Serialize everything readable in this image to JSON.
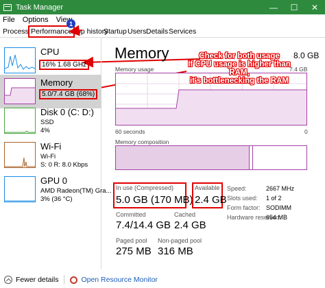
{
  "window": {
    "title": "Task Manager",
    "controls": [
      "—",
      "☐",
      "✕"
    ]
  },
  "menu": [
    "File",
    "Options",
    "View"
  ],
  "tabs": [
    "Processes",
    "Performance",
    "App history",
    "Startup",
    "Users",
    "Details",
    "Services"
  ],
  "badge": "1",
  "sidebar": [
    {
      "name": "CPU",
      "sub": "16%  1.68 GHz",
      "color": "#1a8be6"
    },
    {
      "name": "Memory",
      "sub": "5.0/7.4 GB (68%)",
      "color": "#a53fa5"
    },
    {
      "name": "Disk 0 (C: D:)",
      "sub1": "SSD",
      "sub2": "4%",
      "color": "#4aa63f"
    },
    {
      "name": "Wi-Fi",
      "sub1": "Wi-Fi",
      "sub2": "S: 0 R: 8.0 Kbps",
      "color": "#a9632a"
    },
    {
      "name": "GPU 0",
      "sub1": "AMD Radeon(TM) Gra...",
      "sub2": "3% (36 °C)",
      "color": "#1a8be6"
    }
  ],
  "main": {
    "title": "Memory",
    "total": "8.0 GB",
    "usage_label": "Memory usage",
    "usage_max": "7.4 GB",
    "time_left": "60 seconds",
    "time_right": "0",
    "composition_label": "Memory composition",
    "usage_fraction": 0.68
  },
  "annotation": {
    "line1": "Check for both usage",
    "line2": "If CPU usage is higher than RAM,",
    "line3": "it's bottlenecking the RAM"
  },
  "stats": {
    "in_use_label": "In use (Compressed)",
    "in_use_val": "5.0 GB (170 MB)",
    "available_label": "Available",
    "available_val": "2.4 GB",
    "committed_label": "Committed",
    "committed_val": "7.4/14.4 GB",
    "cached_label": "Cached",
    "cached_val": "2.4 GB",
    "paged_label": "Paged pool",
    "paged_val": "275 MB",
    "nonpaged_label": "Non-paged pool",
    "nonpaged_val": "316 MB"
  },
  "right_stats": [
    {
      "label": "Speed:",
      "value": "2667 MHz"
    },
    {
      "label": "Slots used:",
      "value": "1 of 2"
    },
    {
      "label": "Form factor:",
      "value": "SODIMM"
    },
    {
      "label": "Hardware reserved:",
      "value": "654 MB"
    }
  ],
  "footer": {
    "fewer": "Fewer details",
    "resmon": "Open Resource Monitor"
  },
  "colors": {
    "title_bar": "#2e8b3e",
    "memory": "#a53fa5",
    "annotation": "#e00000"
  }
}
